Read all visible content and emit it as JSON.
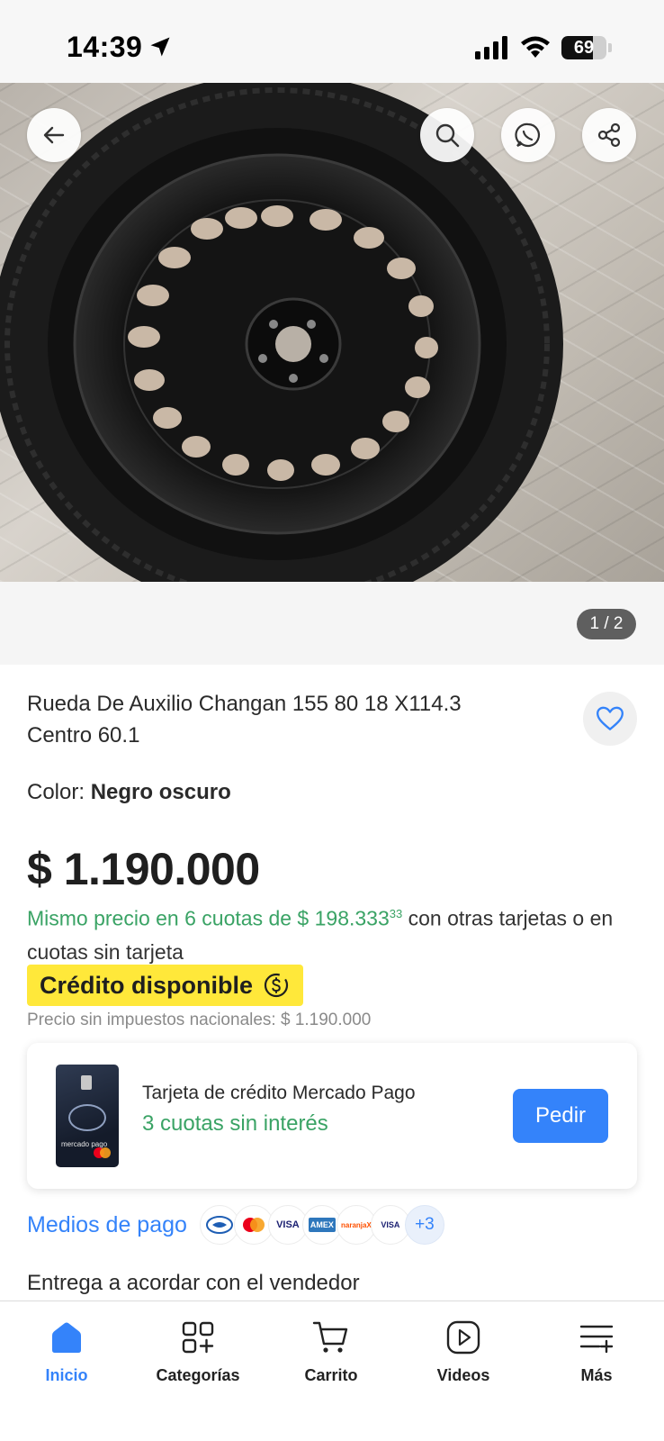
{
  "status_bar": {
    "time": "14:39",
    "battery": "69",
    "battery_level_percent": 69
  },
  "gallery": {
    "counter": "1 / 2"
  },
  "product": {
    "title": "Rueda De Auxilio Changan 155 80 18 X114.3 Centro 60.1",
    "color_label": "Color:",
    "color_value": "Negro oscuro",
    "price": "$ 1.190.000",
    "installments_green": "Mismo precio en 6 cuotas de $ 198.333",
    "installments_cents": "33",
    "installments_rest": " con otras tarjetas o en cuotas sin tarjeta",
    "credit_badge": "Crédito disponible",
    "tax_note": "Precio sin impuestos nacionales: $ 1.190.000"
  },
  "credit_card_offer": {
    "card_brand_text": "mercado pago",
    "title": "Tarjeta de crédito Mercado Pago",
    "subtitle": "3 cuotas sin interés",
    "button": "Pedir"
  },
  "payment": {
    "label": "Medios de pago",
    "logos": [
      "mercadopago-logo",
      "mastercard-logo",
      "VISA",
      "AMEX",
      "naranjaX",
      "VISA",
      "+3"
    ]
  },
  "delivery": "Entrega a acordar con el vendedor",
  "tab_bar": {
    "items": [
      {
        "label": "Inicio",
        "icon": "home-icon",
        "active": true
      },
      {
        "label": "Categorías",
        "icon": "categories-icon",
        "active": false
      },
      {
        "label": "Carrito",
        "icon": "cart-icon",
        "active": false
      },
      {
        "label": "Videos",
        "icon": "video-icon",
        "active": false
      },
      {
        "label": "Más",
        "icon": "more-icon",
        "active": false
      }
    ]
  },
  "colors": {
    "accent_blue": "#3483fa",
    "green": "#3aa365",
    "credit_yellow": "#ffe83a"
  }
}
